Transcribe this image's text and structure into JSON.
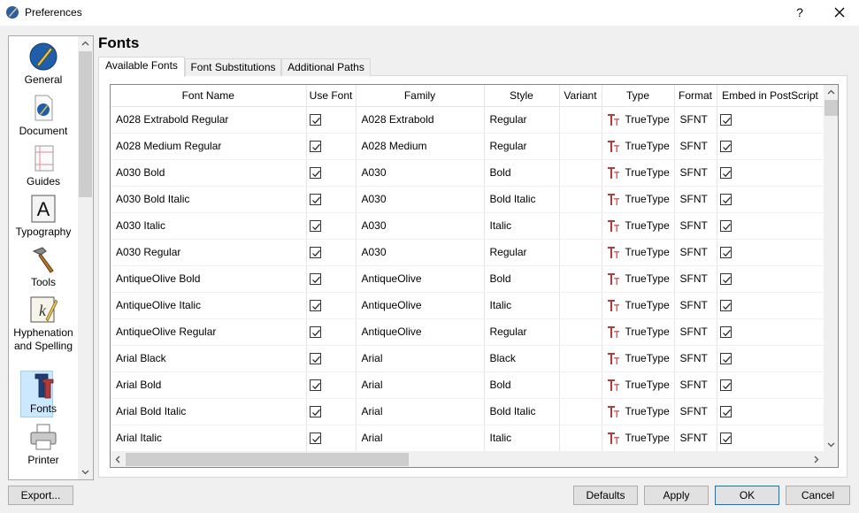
{
  "window": {
    "title": "Preferences",
    "help_label": "?"
  },
  "sidebar": {
    "items": [
      {
        "label": "General"
      },
      {
        "label": "Document"
      },
      {
        "label": "Guides"
      },
      {
        "label": "Typography"
      },
      {
        "label": "Tools"
      },
      {
        "label": "Hyphenation and Spelling"
      },
      {
        "label": "Fonts"
      },
      {
        "label": "Printer"
      }
    ],
    "selected": "Fonts"
  },
  "page": {
    "title": "Fonts"
  },
  "tabs": [
    {
      "label": "Available Fonts",
      "active": true
    },
    {
      "label": "Font Substitutions",
      "active": false
    },
    {
      "label": "Additional Paths",
      "active": false
    }
  ],
  "table": {
    "columns": [
      "Font Name",
      "Use Font",
      "Family",
      "Style",
      "Variant",
      "Type",
      "Format",
      "Embed in PostScript"
    ],
    "rows": [
      {
        "name": "A028 Extrabold Regular",
        "use": true,
        "family": "A028 Extrabold",
        "style": "Regular",
        "variant": "",
        "type": "TrueType",
        "format": "SFNT",
        "embed": true
      },
      {
        "name": "A028 Medium Regular",
        "use": true,
        "family": "A028 Medium",
        "style": "Regular",
        "variant": "",
        "type": "TrueType",
        "format": "SFNT",
        "embed": true
      },
      {
        "name": "A030 Bold",
        "use": true,
        "family": "A030",
        "style": "Bold",
        "variant": "",
        "type": "TrueType",
        "format": "SFNT",
        "embed": true
      },
      {
        "name": "A030 Bold Italic",
        "use": true,
        "family": "A030",
        "style": "Bold Italic",
        "variant": "",
        "type": "TrueType",
        "format": "SFNT",
        "embed": true
      },
      {
        "name": "A030 Italic",
        "use": true,
        "family": "A030",
        "style": "Italic",
        "variant": "",
        "type": "TrueType",
        "format": "SFNT",
        "embed": true
      },
      {
        "name": "A030 Regular",
        "use": true,
        "family": "A030",
        "style": "Regular",
        "variant": "",
        "type": "TrueType",
        "format": "SFNT",
        "embed": true
      },
      {
        "name": "AntiqueOlive Bold",
        "use": true,
        "family": "AntiqueOlive",
        "style": "Bold",
        "variant": "",
        "type": "TrueType",
        "format": "SFNT",
        "embed": true
      },
      {
        "name": "AntiqueOlive Italic",
        "use": true,
        "family": "AntiqueOlive",
        "style": "Italic",
        "variant": "",
        "type": "TrueType",
        "format": "SFNT",
        "embed": true
      },
      {
        "name": "AntiqueOlive Regular",
        "use": true,
        "family": "AntiqueOlive",
        "style": "Regular",
        "variant": "",
        "type": "TrueType",
        "format": "SFNT",
        "embed": true
      },
      {
        "name": "Arial Black",
        "use": true,
        "family": "Arial",
        "style": "Black",
        "variant": "",
        "type": "TrueType",
        "format": "SFNT",
        "embed": true
      },
      {
        "name": "Arial Bold",
        "use": true,
        "family": "Arial",
        "style": "Bold",
        "variant": "",
        "type": "TrueType",
        "format": "SFNT",
        "embed": true
      },
      {
        "name": "Arial Bold Italic",
        "use": true,
        "family": "Arial",
        "style": "Bold Italic",
        "variant": "",
        "type": "TrueType",
        "format": "SFNT",
        "embed": true
      },
      {
        "name": "Arial Italic",
        "use": true,
        "family": "Arial",
        "style": "Italic",
        "variant": "",
        "type": "TrueType",
        "format": "SFNT",
        "embed": true
      }
    ]
  },
  "buttons": {
    "export": "Export...",
    "defaults": "Defaults",
    "apply": "Apply",
    "ok": "OK",
    "cancel": "Cancel"
  },
  "colors": {
    "selection": "#cce8ff",
    "truetype_icon": "#b33a3a",
    "accent": "#0078d7"
  }
}
